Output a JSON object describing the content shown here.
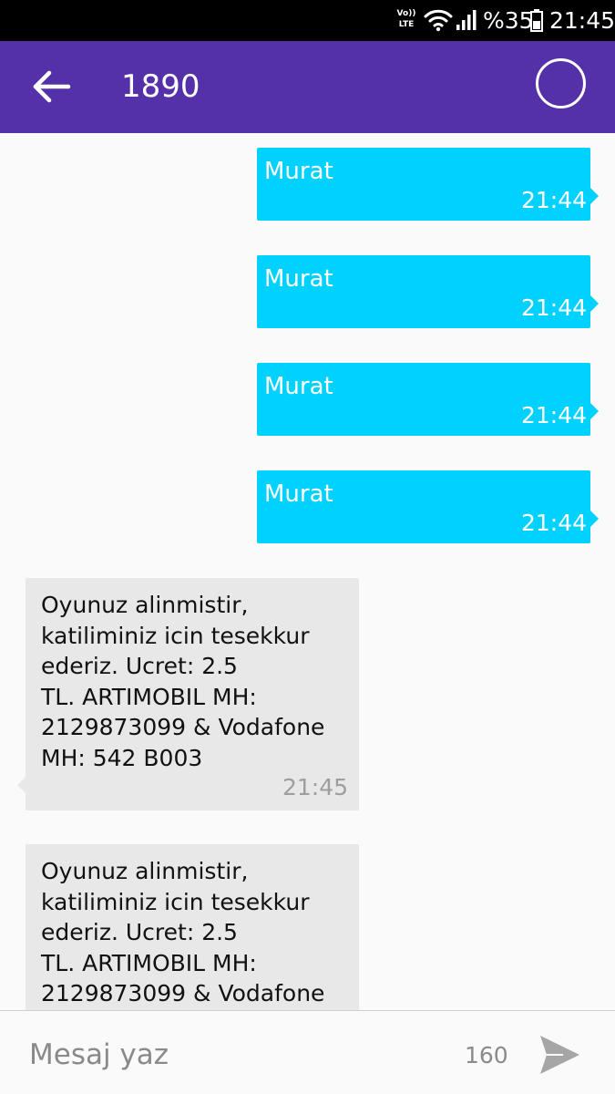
{
  "status_bar": {
    "volte_top": "Vo))",
    "volte_bottom": "LTE",
    "battery_percent": "%35",
    "time": "21:45",
    "icons": [
      "volte-icon",
      "wifi-icon",
      "signal-icon",
      "battery-icon"
    ]
  },
  "app_bar": {
    "back_icon": "arrow-left-icon",
    "title": "1890",
    "contact_icon": "circle-icon"
  },
  "messages": [
    {
      "direction": "outgoing",
      "text": "Murat",
      "time": "21:44"
    },
    {
      "direction": "outgoing",
      "text": "Murat",
      "time": "21:44"
    },
    {
      "direction": "outgoing",
      "text": "Murat",
      "time": "21:44"
    },
    {
      "direction": "outgoing",
      "text": "Murat",
      "time": "21:44"
    },
    {
      "direction": "incoming",
      "text": "Oyunuz alinmistir,\nkatiliminiz icin tesekkur\nederiz. Ucret: 2.5\nTL. ARTIMOBIL MH:\n2129873099 & Vodafone\nMH: 542 B003",
      "time": "21:45"
    },
    {
      "direction": "incoming",
      "text": "Oyunuz alinmistir,\nkatiliminiz icin tesekkur\nederiz. Ucret: 2.5\nTL. ARTIMOBIL MH:\n2129873099 & Vodafone"
    }
  ],
  "composer": {
    "placeholder": "Mesaj yaz",
    "value": "",
    "char_count": "160",
    "send_icon": "send-icon"
  },
  "colors": {
    "app_bar": "#5531a9",
    "outgoing_bubble": "#00d1ff",
    "incoming_bubble": "#e8e8e8",
    "background": "#fafafa",
    "send_icon": "#a6a6a6"
  }
}
